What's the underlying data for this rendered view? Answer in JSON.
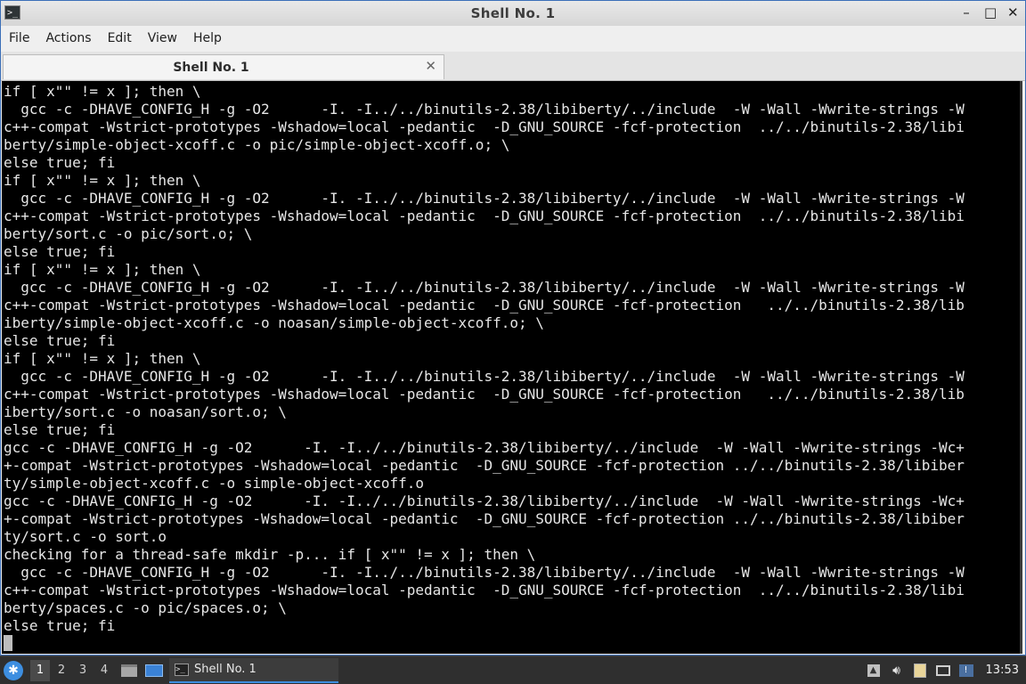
{
  "window": {
    "title": "Shell No. 1",
    "controls": {
      "minimize": "–",
      "maximize": "□",
      "close": "✕"
    }
  },
  "menubar": {
    "items": [
      "File",
      "Actions",
      "Edit",
      "View",
      "Help"
    ]
  },
  "tabs": [
    {
      "label": "Shell No. 1",
      "close": "✕"
    }
  ],
  "terminal": {
    "lines": [
      "if [ x\"\" != x ]; then \\",
      "  gcc -c -DHAVE_CONFIG_H -g -O2      -I. -I../../binutils-2.38/libiberty/../include  -W -Wall -Wwrite-strings -W",
      "c++-compat -Wstrict-prototypes -Wshadow=local -pedantic  -D_GNU_SOURCE -fcf-protection  ../../binutils-2.38/libi",
      "berty/simple-object-xcoff.c -o pic/simple-object-xcoff.o; \\",
      "else true; fi",
      "if [ x\"\" != x ]; then \\",
      "  gcc -c -DHAVE_CONFIG_H -g -O2      -I. -I../../binutils-2.38/libiberty/../include  -W -Wall -Wwrite-strings -W",
      "c++-compat -Wstrict-prototypes -Wshadow=local -pedantic  -D_GNU_SOURCE -fcf-protection  ../../binutils-2.38/libi",
      "berty/sort.c -o pic/sort.o; \\",
      "else true; fi",
      "if [ x\"\" != x ]; then \\",
      "  gcc -c -DHAVE_CONFIG_H -g -O2      -I. -I../../binutils-2.38/libiberty/../include  -W -Wall -Wwrite-strings -W",
      "c++-compat -Wstrict-prototypes -Wshadow=local -pedantic  -D_GNU_SOURCE -fcf-protection   ../../binutils-2.38/lib",
      "iberty/simple-object-xcoff.c -o noasan/simple-object-xcoff.o; \\",
      "else true; fi",
      "if [ x\"\" != x ]; then \\",
      "  gcc -c -DHAVE_CONFIG_H -g -O2      -I. -I../../binutils-2.38/libiberty/../include  -W -Wall -Wwrite-strings -W",
      "c++-compat -Wstrict-prototypes -Wshadow=local -pedantic  -D_GNU_SOURCE -fcf-protection   ../../binutils-2.38/lib",
      "iberty/sort.c -o noasan/sort.o; \\",
      "else true; fi",
      "gcc -c -DHAVE_CONFIG_H -g -O2      -I. -I../../binutils-2.38/libiberty/../include  -W -Wall -Wwrite-strings -Wc+",
      "+-compat -Wstrict-prototypes -Wshadow=local -pedantic  -D_GNU_SOURCE -fcf-protection ../../binutils-2.38/libiber",
      "ty/simple-object-xcoff.c -o simple-object-xcoff.o",
      "gcc -c -DHAVE_CONFIG_H -g -O2      -I. -I../../binutils-2.38/libiberty/../include  -W -Wall -Wwrite-strings -Wc+",
      "+-compat -Wstrict-prototypes -Wshadow=local -pedantic  -D_GNU_SOURCE -fcf-protection ../../binutils-2.38/libiber",
      "ty/sort.c -o sort.o",
      "checking for a thread-safe mkdir -p... if [ x\"\" != x ]; then \\",
      "  gcc -c -DHAVE_CONFIG_H -g -O2      -I. -I../../binutils-2.38/libiberty/../include  -W -Wall -Wwrite-strings -W",
      "c++-compat -Wstrict-prototypes -Wshadow=local -pedantic  -D_GNU_SOURCE -fcf-protection  ../../binutils-2.38/libi",
      "berty/spaces.c -o pic/spaces.o; \\",
      "else true; fi"
    ]
  },
  "taskbar": {
    "workspaces": [
      "1",
      "2",
      "3",
      "4"
    ],
    "active_workspace": "1",
    "task_label": "Shell No. 1",
    "clock": "13:53"
  }
}
